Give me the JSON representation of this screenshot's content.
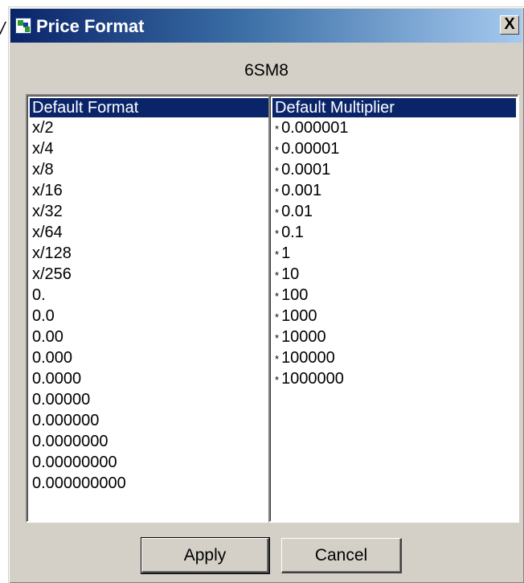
{
  "window": {
    "title": "Price Format",
    "close_label": "X",
    "symbol": "6SM8"
  },
  "format_list": {
    "header": "Default Format",
    "items": [
      "x/2",
      "x/4",
      "x/8",
      "x/16",
      "x/32",
      "x/64",
      "x/128",
      "x/256",
      "0.",
      "0.0",
      "0.00",
      "0.000",
      "0.0000",
      "0.00000",
      "0.000000",
      "0.0000000",
      "0.00000000",
      "0.000000000"
    ]
  },
  "multiplier_list": {
    "header": "Default Multiplier",
    "prefix": "*",
    "items": [
      "0.000001",
      "0.00001",
      "0.0001",
      "0.001",
      "0.01",
      "0.1",
      "1",
      "10",
      "100",
      "1000",
      "10000",
      "100000",
      "1000000"
    ]
  },
  "buttons": {
    "apply": "Apply",
    "cancel": "Cancel"
  },
  "colors": {
    "title_bar_start": "#0a246a",
    "title_bar_end": "#a6caf0",
    "selection": "#0a246a",
    "dialog_face": "#d4d0c8"
  }
}
